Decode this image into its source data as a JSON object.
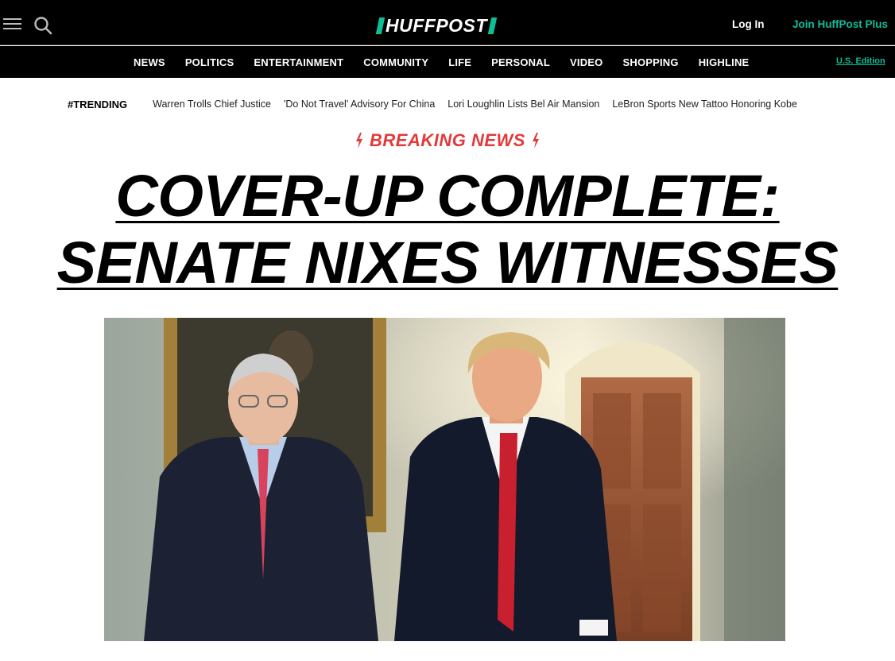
{
  "header": {
    "logo_text": "HUFFPOST",
    "login_label": "Log In",
    "join_label": "Join HuffPost Plus",
    "icons": [
      "menu-icon",
      "search-icon"
    ]
  },
  "nav": {
    "items": [
      "NEWS",
      "POLITICS",
      "ENTERTAINMENT",
      "COMMUNITY",
      "LIFE",
      "PERSONAL",
      "VIDEO",
      "SHOPPING",
      "HIGHLINE"
    ],
    "edition_label": "U.S. Edition"
  },
  "trending": {
    "label": "TRENDING",
    "links": [
      "Warren Trolls Chief Justice",
      "'Do Not Travel' Advisory For China",
      "Lori Loughlin Lists Bel Air Mansion",
      "LeBron Sports New Tattoo Honoring Kobe"
    ]
  },
  "breaking": {
    "label": "BREAKING NEWS"
  },
  "headline": {
    "line1": "COVER-UP COMPLETE:",
    "line2": "SENATE NIXES WITNESSES"
  },
  "colors": {
    "brand_green": "#0dbe98",
    "breaking_red": "#e23a3a",
    "header_bg": "#000000"
  }
}
